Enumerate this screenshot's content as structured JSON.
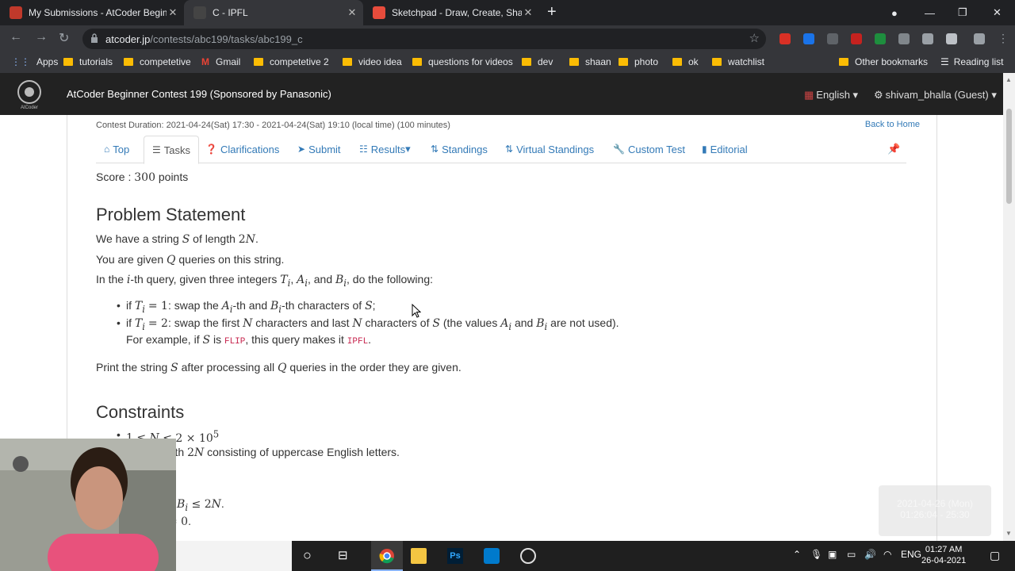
{
  "tabs": [
    {
      "title": "My Submissions - AtCoder Beginner Contest",
      "favicon": "php-logo",
      "color": "#c0392b"
    },
    {
      "title": "C - IPFL",
      "favicon": "atcoder-favicon",
      "color": "#444444"
    },
    {
      "title": "Sketchpad - Draw, Create, Share!",
      "favicon": "sketchpad-icon",
      "color": "#e74c3c"
    }
  ],
  "browser": {
    "url_host": "atcoder.jp",
    "url_path": "/contests/abc199/tasks/abc199_c"
  },
  "bookmarks": [
    {
      "label": "Apps",
      "icon": "apps-grid-icon"
    },
    {
      "label": "tutorials"
    },
    {
      "label": "competetive"
    },
    {
      "label": "Gmail",
      "icon": "gmail-icon"
    },
    {
      "label": "competetive 2"
    },
    {
      "label": "video idea"
    },
    {
      "label": "questions for videos"
    },
    {
      "label": "dev"
    },
    {
      "label": "shaan"
    },
    {
      "label": "photo"
    },
    {
      "label": "ok"
    },
    {
      "label": "watchlist"
    },
    {
      "label": "Other bookmarks"
    },
    {
      "label": "Reading list",
      "icon": "reading-list-icon"
    }
  ],
  "header": {
    "title": "AtCoder Beginner Contest 199 (Sponsored by Panasonic)",
    "language": "English",
    "user": "shivam_bhalla (Guest)"
  },
  "contest": {
    "duration": "Contest Duration: 2021-04-24(Sat) 17:30 - 2021-04-24(Sat) 19:10 (local time) (100 minutes)",
    "back_home": "Back to Home"
  },
  "nav": [
    {
      "label": "Top",
      "icon": "home-icon"
    },
    {
      "label": "Tasks",
      "icon": "list-icon",
      "active": true
    },
    {
      "label": "Clarifications",
      "icon": "question-icon"
    },
    {
      "label": "Submit",
      "icon": "send-icon"
    },
    {
      "label": "Results",
      "icon": "list-bullet-icon"
    },
    {
      "label": "Standings",
      "icon": "sort-icon"
    },
    {
      "label": "Virtual Standings",
      "icon": "sort-icon"
    },
    {
      "label": "Custom Test",
      "icon": "wrench-icon"
    },
    {
      "label": "Editorial",
      "icon": "book-icon"
    }
  ],
  "problem": {
    "score_label": "Score : ",
    "score_value": "300",
    "score_unit": " points",
    "statement_heading": "Problem Statement",
    "constraints_heading": "Constraints"
  },
  "taskbar": {
    "time": "01:27 AM",
    "date": "26-04-2021",
    "lang": "ENG"
  },
  "overlay": {
    "timestamp": "2021-04-26 (Mon) 01:26:04 - 25:30"
  }
}
